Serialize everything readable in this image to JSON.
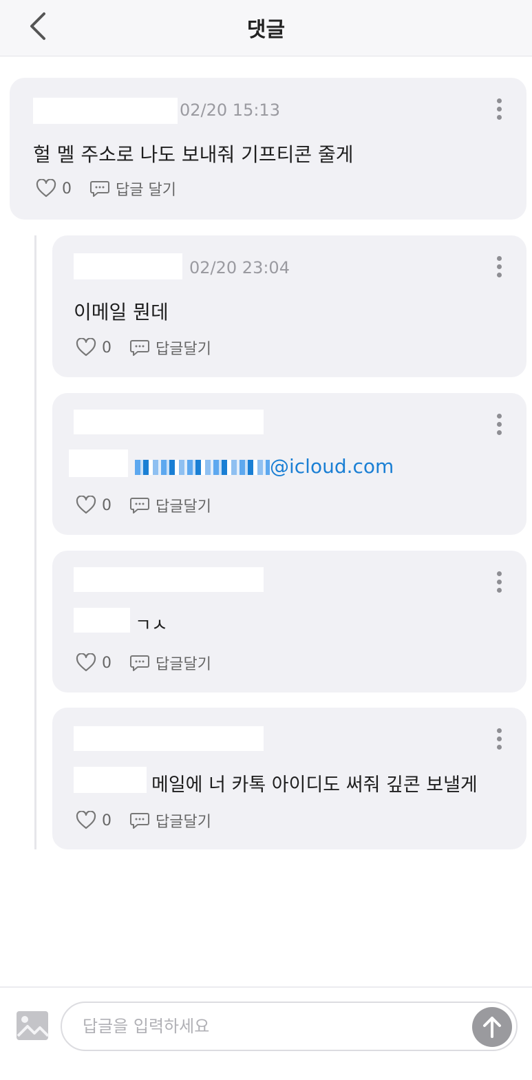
{
  "header": {
    "title": "댓글"
  },
  "comments": [
    {
      "date": "02/20 15:13",
      "text": "헐 멜 주소로 나도 보내줘 기프티콘 줄게",
      "likes": "0",
      "reply_label": "답글 달기"
    }
  ],
  "replies": [
    {
      "date": "02/20 23:04",
      "text": "이메일 뭔데",
      "likes": "0",
      "reply_label": "답글달기"
    },
    {
      "text": "@icloud.com",
      "likes": "0",
      "reply_label": "답글달기"
    },
    {
      "text": "ㄱㅅ",
      "likes": "0",
      "reply_label": "답글달기"
    },
    {
      "text": "메일에 너 카톡 아이디도 써줘 깊콘 보낼게",
      "likes": "0",
      "reply_label": "답글달기"
    }
  ],
  "composer": {
    "placeholder": "답글을 입력하세요"
  },
  "colors": {
    "card_bg": "#f1f1f5",
    "link": "#1a7fd4",
    "send_button": "#9a9a9e"
  }
}
